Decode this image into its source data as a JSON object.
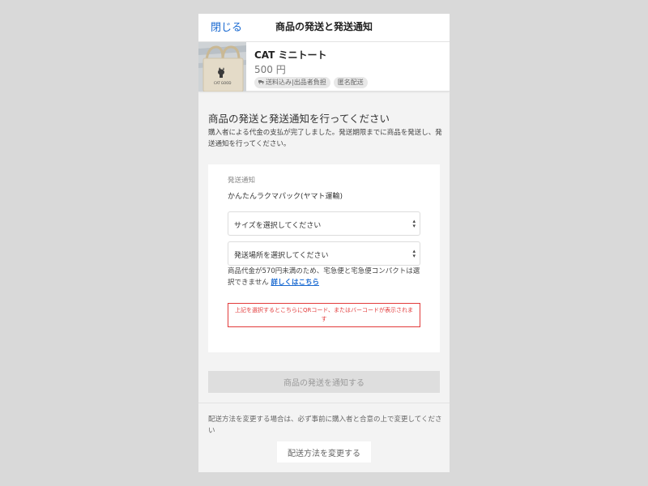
{
  "header": {
    "close_label": "閉じる",
    "title": "商品の発送と発送通知"
  },
  "item": {
    "name": "CAT ミニトート",
    "price": "500 円",
    "badges": [
      {
        "icon": "truck-icon",
        "label": "送料込み|出品者負担"
      },
      {
        "label": "匿名配送"
      }
    ],
    "thumbnail_icon": "tote-bag-photo",
    "thumbnail_text": "CAT GOOD"
  },
  "section": {
    "title": "商品の発送と発送通知を行ってください",
    "description": "購入者による代金の支払が完了しました。発送期限までに商品を発送し、発送通知を行ってください。"
  },
  "form": {
    "field_label": "発送通知",
    "method": "かんたんラクマパック(ヤマト運輸)",
    "size_select": {
      "value": "サイズを選択してください"
    },
    "place_select": {
      "value": "発送場所を選択してください"
    },
    "note_text": "商品代金が570円未満のため、宅急便と宅急便コンパクトは選択できません",
    "note_link": "詳しくはこちら",
    "qr_notice": "上記を選択するとこちらにQRコード、またはバーコードが表示されます"
  },
  "notify_button": {
    "label": "商品の発送を通知する",
    "state": "disabled"
  },
  "change": {
    "note": "配送方法を変更する場合は、必ず事前に購入者と合意の上で変更してください",
    "button_label": "配送方法を変更する"
  },
  "colors": {
    "accent": "#1a6ad1",
    "warning": "#e23b3b",
    "background": "#d9d9d9",
    "panel": "#f3f3f3"
  }
}
